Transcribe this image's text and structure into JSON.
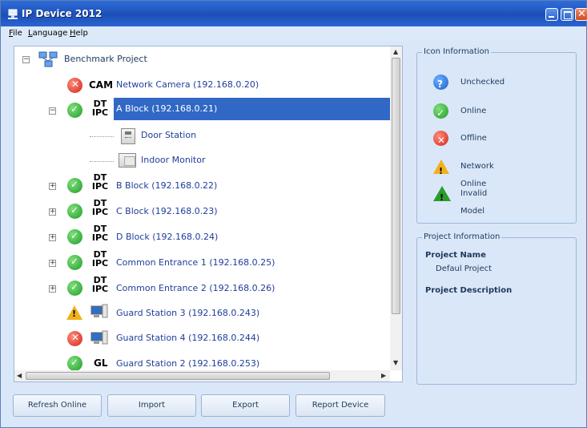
{
  "window": {
    "title": "IP Device 2012"
  },
  "menu": {
    "file": "File",
    "language": "Language",
    "help": "Help"
  },
  "tree": {
    "root": "Benchmark Project",
    "nodes": [
      {
        "label": "Network Camera (192.168.0.20)",
        "status": "offline",
        "badge": "CAM"
      },
      {
        "label": "A Block (192.168.0.21)",
        "status": "online",
        "badge": "DT IPC",
        "selected": true
      },
      {
        "label": "Door Station",
        "child": true
      },
      {
        "label": "Indoor Monitor",
        "child": true
      },
      {
        "label": "B Block (192.168.0.22)",
        "status": "online",
        "badge": "DT IPC"
      },
      {
        "label": "C Block (192.168.0.23)",
        "status": "online",
        "badge": "DT IPC"
      },
      {
        "label": "D Block (192.168.0.24)",
        "status": "online",
        "badge": "DT IPC"
      },
      {
        "label": "Common Entrance 1 (192.168.0.25)",
        "status": "online",
        "badge": "DT IPC"
      },
      {
        "label": "Common Entrance 2 (192.168.0.26)",
        "status": "online",
        "badge": "DT IPC"
      },
      {
        "label": "Guard Station 3 (192.168.0.243)",
        "status": "network-online",
        "badge": "pc"
      },
      {
        "label": "Guard Station 4 (192.168.0.244)",
        "status": "offline",
        "badge": "pc"
      },
      {
        "label": "Guard Station 2 (192.168.0.253)",
        "status": "online",
        "badge": "GL"
      }
    ]
  },
  "badges": {
    "cam": "CAM",
    "dt": "DT",
    "ipc": "IPC",
    "gl": "GL"
  },
  "icon_info": {
    "title": "Icon Information",
    "items": [
      {
        "label": "Unchecked",
        "icon": "question-icon"
      },
      {
        "label": "Online",
        "icon": "check-icon"
      },
      {
        "label": "Offline",
        "icon": "cross-icon"
      },
      {
        "label": "Network Online",
        "icon": "warning-icon"
      },
      {
        "label": "Invalid Model",
        "icon": "invalid-icon"
      }
    ]
  },
  "project_info": {
    "title": "Project Information",
    "name_label": "Project Name",
    "name_value": "Defaul Project",
    "desc_label": "Project Description"
  },
  "buttons": {
    "refresh": "Refresh Online",
    "import": "Import",
    "export": "Export",
    "report": "Report Device"
  }
}
